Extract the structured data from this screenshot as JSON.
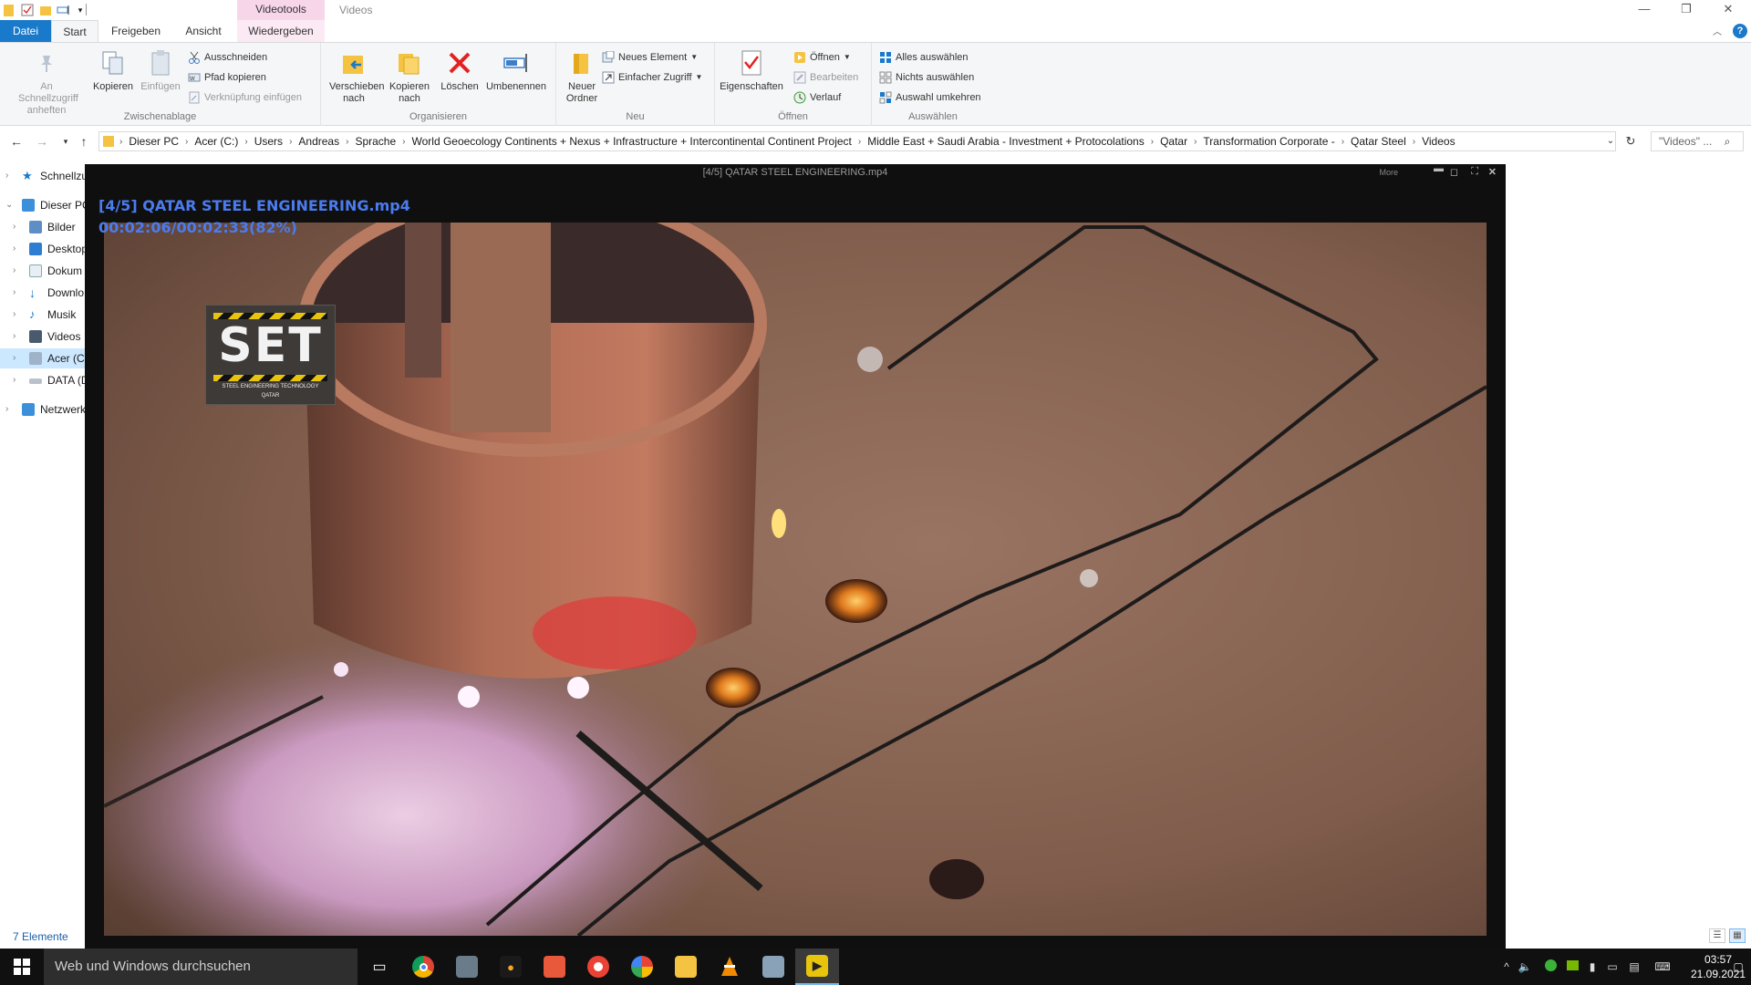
{
  "window": {
    "context_tab": "Videotools",
    "title": "Videos"
  },
  "tabs": {
    "file": "Datei",
    "start": "Start",
    "share": "Freigeben",
    "view": "Ansicht",
    "play": "Wiedergeben"
  },
  "ribbon": {
    "clipboard": {
      "pin": "An Schnellzugriff anheften",
      "copy": "Kopieren",
      "paste": "Einfügen",
      "cut": "Ausschneiden",
      "copy_path": "Pfad kopieren",
      "paste_shortcut": "Verknüpfung einfügen",
      "label": "Zwischenablage"
    },
    "organize": {
      "move_to": "Verschieben nach",
      "copy_to": "Kopieren nach",
      "delete": "Löschen",
      "rename": "Umbenennen",
      "label": "Organisieren"
    },
    "new": {
      "new_folder": "Neuer Ordner",
      "new_item": "Neues Element",
      "easy_access": "Einfacher Zugriff",
      "label": "Neu"
    },
    "open": {
      "properties": "Eigenschaften",
      "open": "Öffnen",
      "edit": "Bearbeiten",
      "history": "Verlauf",
      "label": "Öffnen"
    },
    "select": {
      "select_all": "Alles auswählen",
      "select_none": "Nichts auswählen",
      "invert": "Auswahl umkehren",
      "label": "Auswählen"
    }
  },
  "address": {
    "crumbs": [
      "Dieser PC",
      "Acer (C:)",
      "Users",
      "Andreas",
      "Sprache",
      "World Geoecology Continents + Nexus + Infrastructure + Intercontinental Continent Project",
      "Middle East + Saudi Arabia - Investment + Protocolations",
      "Qatar",
      "Transformation Corporate -",
      "Qatar Steel",
      "Videos"
    ],
    "search_placeholder": "\"Videos\" ..."
  },
  "navpane": {
    "items": [
      {
        "label": "Schnellzu",
        "icon": "star-icon"
      },
      {
        "label": "Dieser PC",
        "icon": "computer-icon"
      },
      {
        "label": "Bilder",
        "icon": "pictures-icon"
      },
      {
        "label": "Desktop",
        "icon": "desktop-icon"
      },
      {
        "label": "Dokum",
        "icon": "documents-icon"
      },
      {
        "label": "Downlo",
        "icon": "downloads-icon"
      },
      {
        "label": "Musik",
        "icon": "music-icon"
      },
      {
        "label": "Videos",
        "icon": "videos-icon"
      },
      {
        "label": "Acer (C",
        "icon": "drive-icon"
      },
      {
        "label": "DATA (D",
        "icon": "drive-icon"
      },
      {
        "label": "Netzwerk",
        "icon": "network-icon"
      }
    ],
    "status": "7 Elemente"
  },
  "player": {
    "title": "[4/5] QATAR STEEL ENGINEERING.mp4",
    "more": "More",
    "osd_title": "[4/5] QATAR STEEL ENGINEERING.mp4",
    "osd_time": "00:02:06/00:02:33(82%)",
    "progress": 0.82,
    "logo_text": "SET",
    "logo_sub1": "STEEL ENGINEERING TECHNOLOGY",
    "logo_sub2": "QATAR"
  },
  "taskbar": {
    "search_placeholder": "Web und Windows durchsuchen",
    "time": "03:57",
    "date": "21.09.2021"
  },
  "colors": {
    "accent": "#1979ca",
    "context_tab": "#f8d6ea",
    "osd_text": "#4a7cf0"
  }
}
